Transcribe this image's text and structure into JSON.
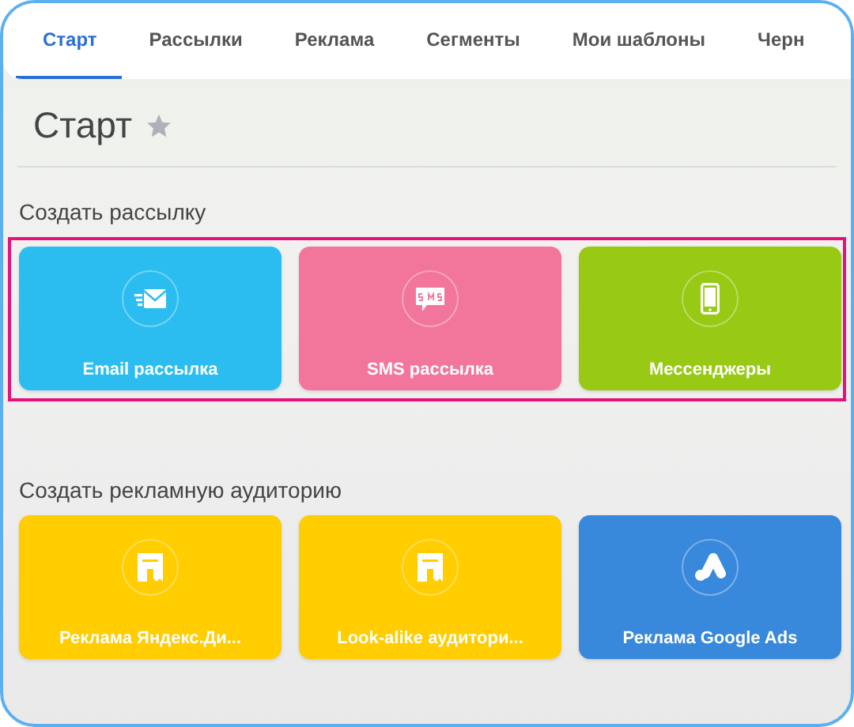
{
  "tabs": [
    {
      "label": "Старт",
      "selected": true
    },
    {
      "label": "Рассылки",
      "selected": false
    },
    {
      "label": "Реклама",
      "selected": false
    },
    {
      "label": "Сегменты",
      "selected": false
    },
    {
      "label": "Мои шаблоны",
      "selected": false
    },
    {
      "label": "Черн",
      "selected": false
    }
  ],
  "page": {
    "title": "Старт",
    "favorite": false
  },
  "sections": [
    {
      "title": "Создать рассылку",
      "highlighted": true,
      "cards": [
        {
          "label": "Email рассылка",
          "kind": "email",
          "color": "#2bbdf0"
        },
        {
          "label": "SMS рассылка",
          "kind": "sms",
          "color": "#f2769b"
        },
        {
          "label": "Мессенджеры",
          "kind": "phone",
          "color": "#98c914"
        }
      ]
    },
    {
      "title": "Создать рекламную аудиторию",
      "highlighted": false,
      "cards": [
        {
          "label": "Реклама Яндекс.Ди...",
          "kind": "ad",
          "color": "#ffcd00"
        },
        {
          "label": "Look-alike аудитори...",
          "kind": "ad",
          "color": "#ffcd00"
        },
        {
          "label": "Реклама Google Ads",
          "kind": "google",
          "color": "#3888dc"
        }
      ]
    }
  ]
}
